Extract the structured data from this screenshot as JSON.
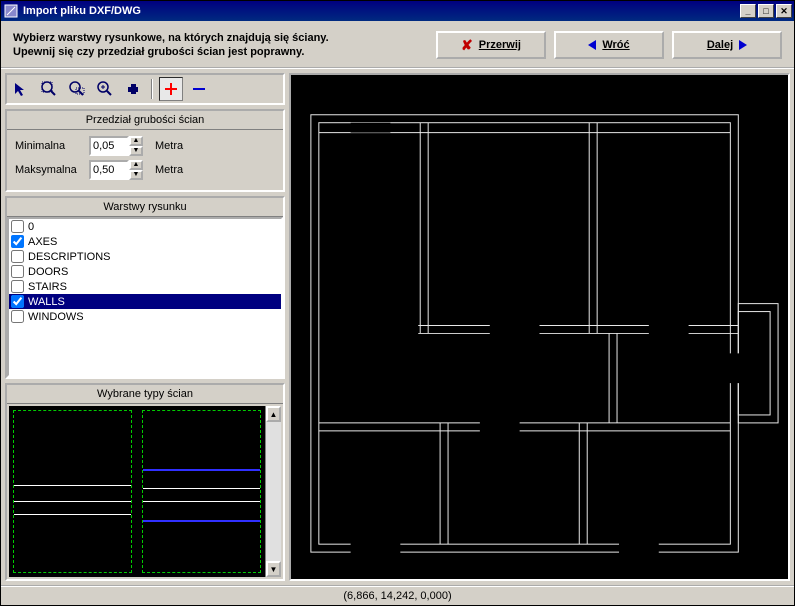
{
  "title": "Import pliku DXF/DWG",
  "header": {
    "line1": "Wybierz warstwy rysunkowe, na których znajdują się ściany.",
    "line2": "Upewnij się czy przedział grubości ścian jest poprawny."
  },
  "buttons": {
    "cancel": "Przerwij",
    "back": "Wróć",
    "next": "Dalej"
  },
  "thickness": {
    "title": "Przedział grubości ścian",
    "min_label": "Minimalna",
    "min_value": "0,05",
    "max_label": "Maksymalna",
    "max_value": "0,50",
    "unit": "Metra"
  },
  "layers": {
    "title": "Warstwy rysunku",
    "items": [
      {
        "name": "0",
        "checked": false,
        "selected": false
      },
      {
        "name": "AXES",
        "checked": true,
        "selected": false
      },
      {
        "name": "DESCRIPTIONS",
        "checked": false,
        "selected": false
      },
      {
        "name": "DOORS",
        "checked": false,
        "selected": false
      },
      {
        "name": "STAIRS",
        "checked": false,
        "selected": false
      },
      {
        "name": "WALLS",
        "checked": true,
        "selected": true
      },
      {
        "name": "WINDOWS",
        "checked": false,
        "selected": false
      }
    ]
  },
  "wall_types": {
    "title": "Wybrane typy ścian"
  },
  "status": "(6,866, 14,242, 0,000)",
  "icons": {
    "pointer": "pointer-icon",
    "zoom_extents": "zoom-extents-icon",
    "zoom_window": "zoom-window-icon",
    "zoom_in": "zoom-in-icon",
    "pan": "pan-icon",
    "plus": "plus-icon",
    "minus": "minus-icon"
  },
  "colors": {
    "accent_red": "#ff0000",
    "accent_blue": "#0000d0",
    "wall_line": "#e8e8e8"
  }
}
